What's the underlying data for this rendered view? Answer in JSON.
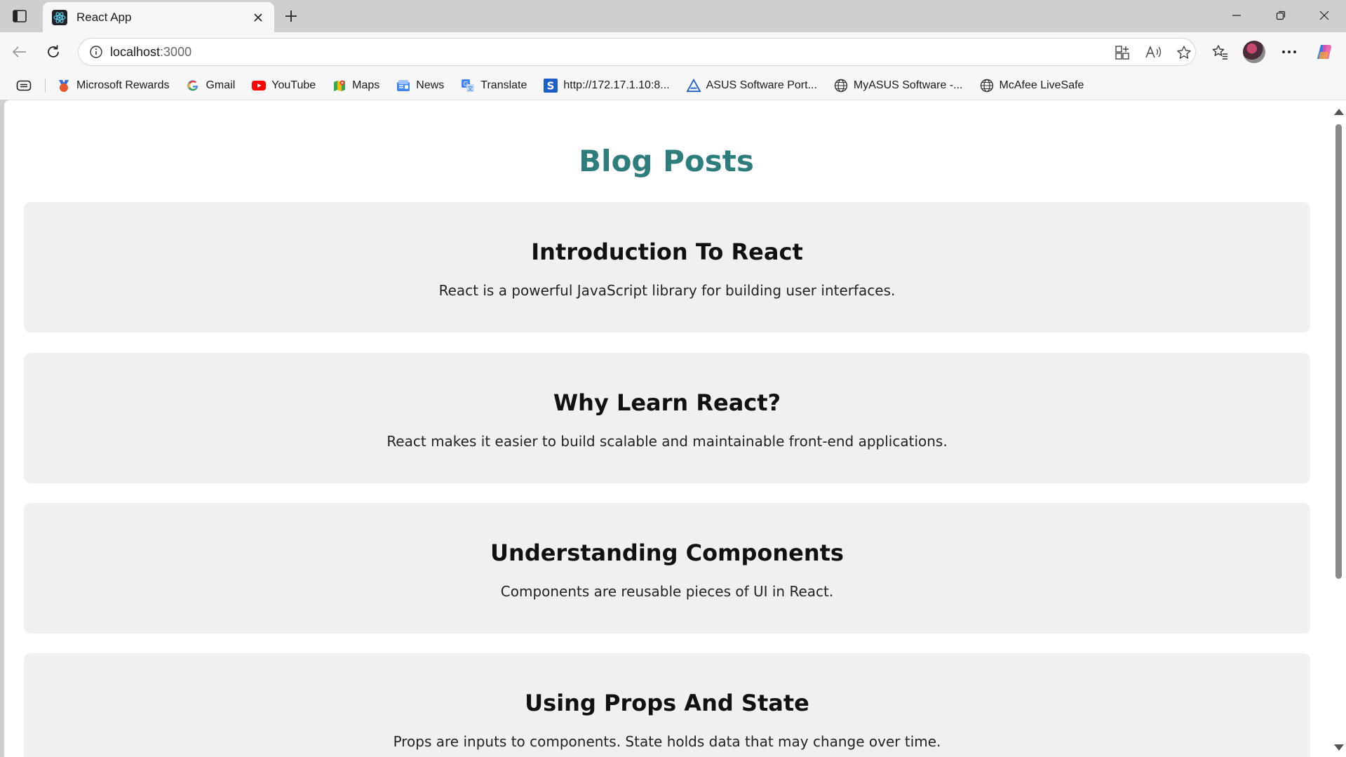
{
  "browser": {
    "tab": {
      "title": "React App",
      "favicon": "react-logo-icon"
    },
    "address": {
      "host": "localhost",
      "port": ":3000"
    },
    "bookmarks": [
      {
        "label": "Microsoft Rewards",
        "icon": "rewards-icon"
      },
      {
        "label": "Gmail",
        "icon": "google-icon"
      },
      {
        "label": "YouTube",
        "icon": "youtube-icon"
      },
      {
        "label": "Maps",
        "icon": "maps-icon"
      },
      {
        "label": "News",
        "icon": "news-icon"
      },
      {
        "label": "Translate",
        "icon": "translate-icon"
      },
      {
        "label": "http://172.17.1.10:8...",
        "icon": "s-site-icon"
      },
      {
        "label": "ASUS Software Port...",
        "icon": "asus-icon"
      },
      {
        "label": "MyASUS Software -...",
        "icon": "globe-icon"
      },
      {
        "label": "McAfee LiveSafe",
        "icon": "globe-icon"
      }
    ]
  },
  "page": {
    "heading": "Blog Posts",
    "posts": [
      {
        "title": "Introduction To React",
        "body": "React is a powerful JavaScript library for building user interfaces."
      },
      {
        "title": "Why Learn React?",
        "body": "React makes it easier to build scalable and maintainable front-end applications."
      },
      {
        "title": "Understanding Components",
        "body": "Components are reusable pieces of UI in React."
      },
      {
        "title": "Using Props And State",
        "body": "Props are inputs to components. State holds data that may change over time."
      }
    ]
  },
  "colors": {
    "heading": "#2e7d7d",
    "card": "#f0f0f0"
  }
}
